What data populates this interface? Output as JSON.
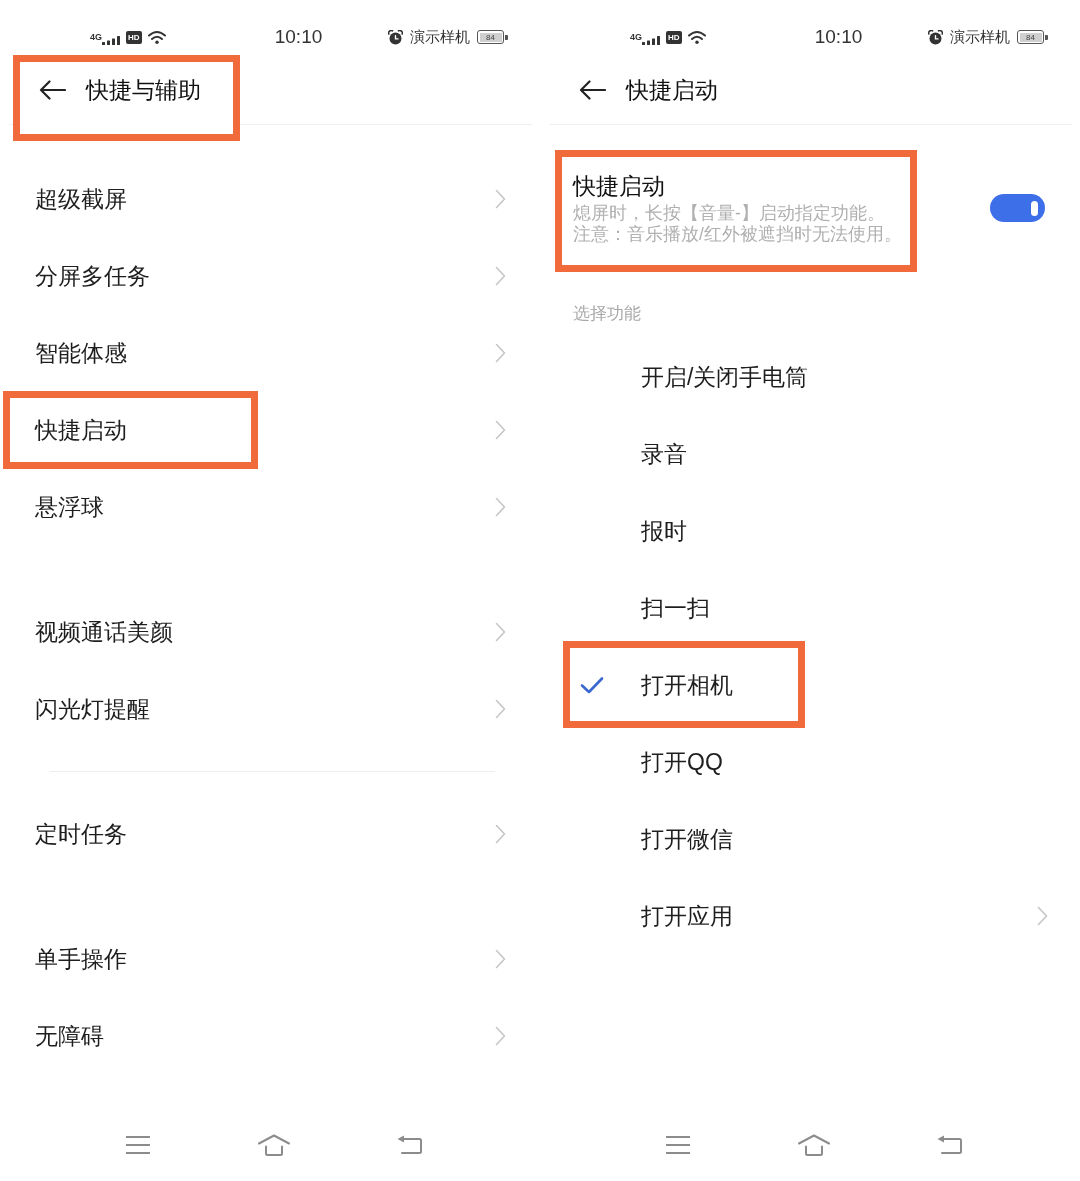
{
  "screens": [
    {
      "kind": "menu",
      "status_bar": {
        "network": "4G",
        "hd": "HD",
        "time": "10:10",
        "device_label": "演示样机",
        "battery": "84"
      },
      "header": {
        "title": "快捷与辅助",
        "highlighted": true
      },
      "groups": [
        {
          "items": [
            {
              "label": "超级截屏",
              "chevron": true,
              "highlighted": false
            },
            {
              "label": "分屏多任务",
              "chevron": true,
              "highlighted": false
            },
            {
              "label": "智能体感",
              "chevron": true,
              "highlighted": false
            },
            {
              "label": "快捷启动",
              "chevron": true,
              "highlighted": true
            },
            {
              "label": "悬浮球",
              "chevron": true,
              "highlighted": false
            }
          ]
        },
        {
          "rule_above": false,
          "items": [
            {
              "label": "视频通话美颜",
              "chevron": true,
              "highlighted": false
            },
            {
              "label": "闪光灯提醒",
              "chevron": true,
              "highlighted": false
            }
          ]
        },
        {
          "rule_above": true,
          "items": [
            {
              "label": "定时任务",
              "chevron": true,
              "highlighted": false
            }
          ]
        },
        {
          "rule_above": false,
          "items": [
            {
              "label": "单手操作",
              "chevron": true,
              "highlighted": false
            },
            {
              "label": "无障碍",
              "chevron": true,
              "highlighted": false
            }
          ]
        }
      ]
    },
    {
      "kind": "options",
      "status_bar": {
        "network": "4G",
        "hd": "HD",
        "time": "10:10",
        "device_label": "演示样机",
        "battery": "84"
      },
      "header": {
        "title": "快捷启动",
        "highlighted": false
      },
      "switch_row": {
        "title": "快捷启动",
        "description": [
          "熄屏时，长按【音量-】启动指定功能。",
          "注意：音乐播放/红外被遮挡时无法使用。"
        ],
        "on": true,
        "highlighted": true
      },
      "section_label": "选择功能",
      "options": [
        {
          "label": "开启/关闭手电筒",
          "selected": false,
          "chevron": false,
          "highlighted": false
        },
        {
          "label": "录音",
          "selected": false,
          "chevron": false,
          "highlighted": false
        },
        {
          "label": "报时",
          "selected": false,
          "chevron": false,
          "highlighted": false
        },
        {
          "label": "扫一扫",
          "selected": false,
          "chevron": false,
          "highlighted": false
        },
        {
          "label": "打开相机",
          "selected": true,
          "chevron": false,
          "highlighted": true
        },
        {
          "label": "打开QQ",
          "selected": false,
          "chevron": false,
          "highlighted": false
        },
        {
          "label": "打开微信",
          "selected": false,
          "chevron": false,
          "highlighted": false
        },
        {
          "label": "打开应用",
          "selected": false,
          "chevron": true,
          "highlighted": false
        }
      ]
    }
  ]
}
